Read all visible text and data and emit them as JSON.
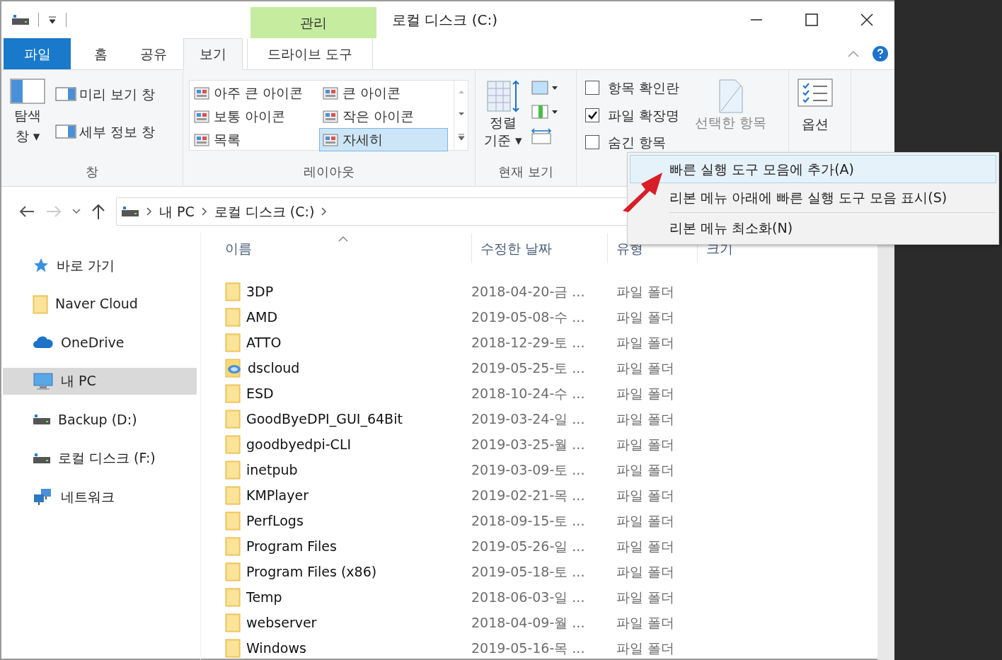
{
  "title_bar": {
    "title": "로컬 디스크 (C:)",
    "context_tab": "관리"
  },
  "ribbon_tabs": [
    {
      "label": "파일",
      "kind": "file",
      "selected": false
    },
    {
      "label": "홈",
      "kind": "tab",
      "selected": false
    },
    {
      "label": "공유",
      "kind": "tab",
      "selected": false
    },
    {
      "label": "보기",
      "kind": "tab",
      "selected": true
    },
    {
      "label": "드라이브 도구",
      "kind": "context",
      "selected": false
    }
  ],
  "ribbon": {
    "pane_group": {
      "label": "창",
      "nav_pane": [
        "탐색",
        "창 ▾"
      ],
      "buttons": [
        "미리 보기 창",
        "세부 정보 창"
      ]
    },
    "layout_group": {
      "label": "레이아웃",
      "options": [
        {
          "label": "아주 큰 아이콘",
          "selected": false
        },
        {
          "label": "큰 아이콘",
          "selected": false
        },
        {
          "label": "보통 아이콘",
          "selected": false
        },
        {
          "label": "작은 아이콘",
          "selected": false
        },
        {
          "label": "목록",
          "selected": false
        },
        {
          "label": "자세히",
          "selected": true
        }
      ]
    },
    "view_group": {
      "label": "현재 보기",
      "sort_button": [
        "정렬",
        "기준 ▾"
      ]
    },
    "show_group": {
      "checkboxes": [
        {
          "label": "항목 확인란",
          "checked": false
        },
        {
          "label": "파일 확장명",
          "checked": true
        },
        {
          "label": "숨긴 항목",
          "checked": false
        }
      ],
      "hide_button": "선택한 항목"
    },
    "options_button": "옵션"
  },
  "address": {
    "crumbs": [
      "내 PC",
      "로컬 디스크 (C:)"
    ]
  },
  "nav_pane": [
    {
      "label": "바로 가기",
      "kind": "star",
      "selected": false
    },
    {
      "label": "Naver Cloud",
      "kind": "folder",
      "selected": false
    },
    {
      "label": "OneDrive",
      "kind": "cloud",
      "selected": false
    },
    {
      "label": "내 PC",
      "kind": "pc",
      "selected": true
    },
    {
      "label": "Backup (D:)",
      "kind": "drive",
      "selected": false
    },
    {
      "label": "로컬 디스크 (F:)",
      "kind": "drive",
      "selected": false
    },
    {
      "label": "네트워크",
      "kind": "network",
      "selected": false
    }
  ],
  "file_list": {
    "columns": [
      "이름",
      "수정한 날짜",
      "유형",
      "크기"
    ],
    "rows": [
      {
        "name": "3DP",
        "date": "2018-04-20-금 ...",
        "type": "파일 폴더",
        "kind": "folder"
      },
      {
        "name": "AMD",
        "date": "2019-05-08-수 ...",
        "type": "파일 폴더",
        "kind": "folder"
      },
      {
        "name": "ATTO",
        "date": "2018-12-29-토 ...",
        "type": "파일 폴더",
        "kind": "folder"
      },
      {
        "name": "dscloud",
        "date": "2019-05-25-토 ...",
        "type": "파일 폴더",
        "kind": "cloud-folder"
      },
      {
        "name": "ESD",
        "date": "2018-10-24-수 ...",
        "type": "파일 폴더",
        "kind": "folder"
      },
      {
        "name": "GoodByeDPI_GUI_64Bit",
        "date": "2019-03-24-일 ...",
        "type": "파일 폴더",
        "kind": "folder"
      },
      {
        "name": "goodbyedpi-CLI",
        "date": "2019-03-25-월 ...",
        "type": "파일 폴더",
        "kind": "folder"
      },
      {
        "name": "inetpub",
        "date": "2019-03-09-토 ...",
        "type": "파일 폴더",
        "kind": "folder"
      },
      {
        "name": "KMPlayer",
        "date": "2019-02-21-목 ...",
        "type": "파일 폴더",
        "kind": "folder"
      },
      {
        "name": "PerfLogs",
        "date": "2018-09-15-토 ...",
        "type": "파일 폴더",
        "kind": "folder"
      },
      {
        "name": "Program Files",
        "date": "2019-05-26-일 ...",
        "type": "파일 폴더",
        "kind": "folder"
      },
      {
        "name": "Program Files (x86)",
        "date": "2019-05-18-토 ...",
        "type": "파일 폴더",
        "kind": "folder"
      },
      {
        "name": "Temp",
        "date": "2018-06-03-일 ...",
        "type": "파일 폴더",
        "kind": "folder"
      },
      {
        "name": "webserver",
        "date": "2018-04-09-월 ...",
        "type": "파일 폴더",
        "kind": "folder"
      },
      {
        "name": "Windows",
        "date": "2019-05-16-목 ...",
        "type": "파일 폴더",
        "kind": "folder"
      }
    ]
  },
  "context_menu": [
    {
      "label": "빠른 실행 도구 모음에 추가(A)",
      "selected": true
    },
    {
      "label": "리본 메뉴 아래에 빠른 실행 도구 모음 표시(S)",
      "selected": false
    },
    {
      "label": "리본 메뉴 최소화(N)",
      "selected": false
    }
  ]
}
